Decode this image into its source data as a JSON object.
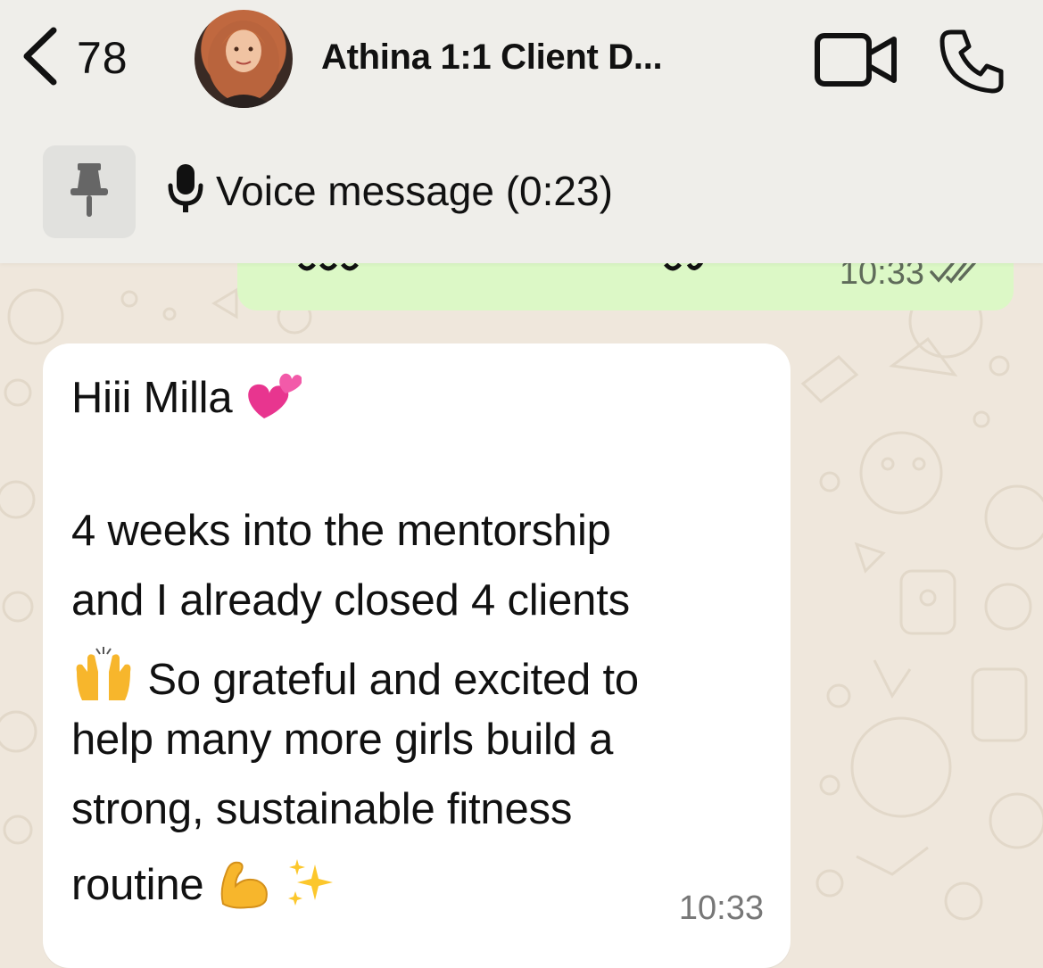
{
  "header": {
    "back_count": "78",
    "chat_title": "Athina 1:1 Client D...",
    "icons": [
      "back-chevron-icon",
      "video-call-icon",
      "phone-call-icon"
    ]
  },
  "pinned": {
    "icon": "pin-icon",
    "mic_icon": "microphone-icon",
    "text": "Voice message (0:23)"
  },
  "messages": {
    "outgoing": {
      "time": "10:33",
      "status_icon": "double-check-icon"
    },
    "incoming": {
      "lines": [
        "Hiii Milla",
        "",
        "4 weeks into the mentorship",
        "and I already closed 4 clients",
        "So grateful and excited to",
        "help many more girls build a",
        "strong, sustainable fitness",
        "routine"
      ],
      "emojis": [
        "two-hearts-emoji",
        "raised-hands-emoji",
        "flexed-biceps-emoji",
        "sparkles-emoji"
      ],
      "time": "10:33"
    }
  },
  "colors": {
    "header_bg": "#efeeea",
    "chat_bg": "#efe7dc",
    "outgoing_bubble": "#dcf8c6",
    "incoming_bubble": "#ffffff"
  }
}
